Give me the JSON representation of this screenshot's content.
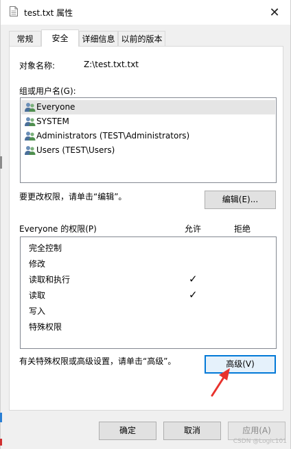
{
  "window": {
    "title": "test.txt 属性"
  },
  "tabs": [
    {
      "label": "常规",
      "active": false
    },
    {
      "label": "安全",
      "active": true
    },
    {
      "label": "详细信息",
      "active": false
    },
    {
      "label": "以前的版本",
      "active": false
    }
  ],
  "security": {
    "object_label": "对象名称:",
    "object_value": "Z:\\test.txt.txt",
    "groups_label": "组或用户名(G):",
    "users": [
      {
        "name": "Everyone",
        "selected": true
      },
      {
        "name": "SYSTEM",
        "selected": false
      },
      {
        "name": "Administrators (TEST\\Administrators)",
        "selected": false
      },
      {
        "name": "Users (TEST\\Users)",
        "selected": false
      }
    ],
    "change_hint": "要更改权限，请单击“编辑”。",
    "edit_button": "编辑(E)...",
    "permissions_label": "Everyone 的权限(P)",
    "allow_header": "允许",
    "deny_header": "拒绝",
    "permissions": [
      {
        "name": "完全控制",
        "allow": false,
        "deny": false
      },
      {
        "name": "修改",
        "allow": false,
        "deny": false
      },
      {
        "name": "读取和执行",
        "allow": true,
        "deny": false
      },
      {
        "name": "读取",
        "allow": true,
        "deny": false
      },
      {
        "name": "写入",
        "allow": false,
        "deny": false
      },
      {
        "name": "特殊权限",
        "allow": false,
        "deny": false
      }
    ],
    "advanced_hint": "有关特殊权限或高级设置，请单击“高级”。",
    "advanced_button": "高级(V)"
  },
  "footer": {
    "ok": "确定",
    "cancel": "取消",
    "apply": "应用(A)"
  },
  "checkmark": "✓",
  "watermark": "CSDN @Logic101",
  "colors": {
    "focus": "#0078d7",
    "annotation_arrow": "#e8322d"
  }
}
